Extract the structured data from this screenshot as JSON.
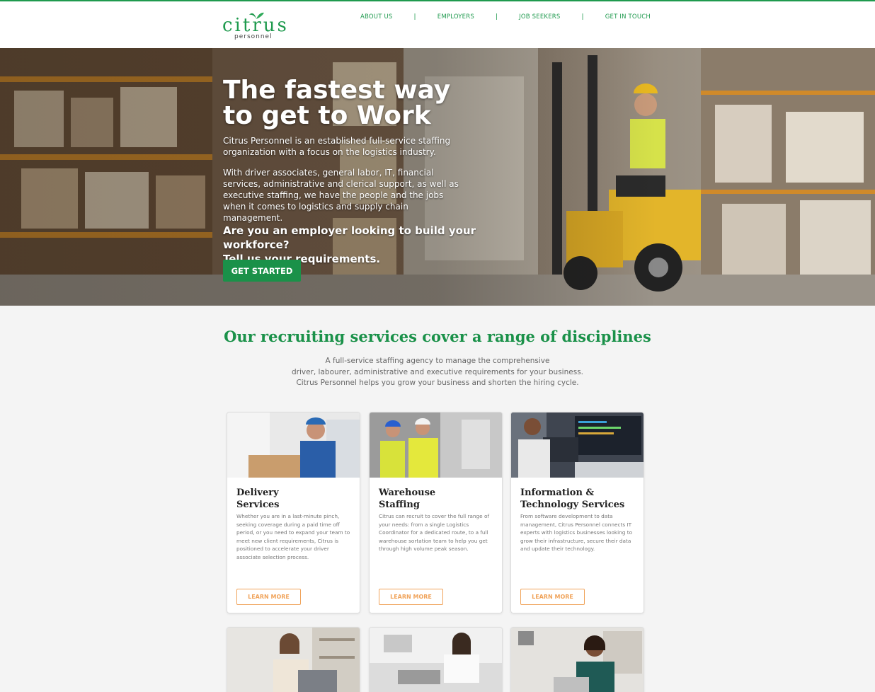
{
  "brand": {
    "logo_word": "citrus",
    "logo_sub": "personnel",
    "green": "#1a9149",
    "orange": "#f0a35a"
  },
  "nav": {
    "items": [
      {
        "label": "ABOUT US"
      },
      {
        "label": "EMPLOYERS"
      },
      {
        "label": "JOB SEEKERS"
      },
      {
        "label": "GET IN TOUCH"
      }
    ],
    "separator": "|"
  },
  "hero": {
    "title_line1": "The fastest way",
    "title_line2": "to get to Work",
    "p1": "Citrus Personnel is an established full-service staffing organization with a focus on the logistics industry.",
    "p2": "With driver associates, general labor, IT, financial services, administrative and clerical support, as well as executive staffing, we have the people and the jobs when it comes to logistics and supply chain management.",
    "cta_line1": "Are you an employer looking to build your workforce?",
    "cta_line2": "Tell us your requirements.",
    "button": "GET STARTED",
    "background": "warehouse-forklift-photo"
  },
  "services": {
    "title": "Our recruiting services cover a range of disciplines",
    "subtitle_lines": [
      "A full-service staffing agency to manage the comprehensive",
      "driver, labourer, administrative and executive requirements for your business.",
      "Citrus Personnel helps you grow your business and shorten the hiring cycle."
    ],
    "cards": [
      {
        "title_line1": "Delivery",
        "title_line2": "Services",
        "text": "Whether you are in a last-minute pinch, seeking coverage during a paid time off period, or you need to expand your team to meet new client requirements, Citrus is positioned to accelerate your driver associate selection process.",
        "button": "LEARN MORE",
        "image": "delivery-worker-photo"
      },
      {
        "title_line1": "Warehouse",
        "title_line2": "Staffing",
        "text": "Citrus can recruit to cover the full range of your needs: from a single Logistics Coordinator for a dedicated route, to a full warehouse sortation team to help you get through high volume peak season.",
        "button": "LEARN MORE",
        "image": "warehouse-workers-photo"
      },
      {
        "title_line1": "Information &",
        "title_line2": "Technology Services",
        "text": "From software development to data management, Citrus Personnel connects IT experts with logistics businesses looking to grow their infrastructure, secure their data and update their technology.",
        "button": "LEARN MORE",
        "image": "it-developer-photo"
      }
    ],
    "row2_images": [
      "office-woman-laptop-photo",
      "office-desk-woman-photo",
      "businesswoman-portrait-photo"
    ]
  }
}
